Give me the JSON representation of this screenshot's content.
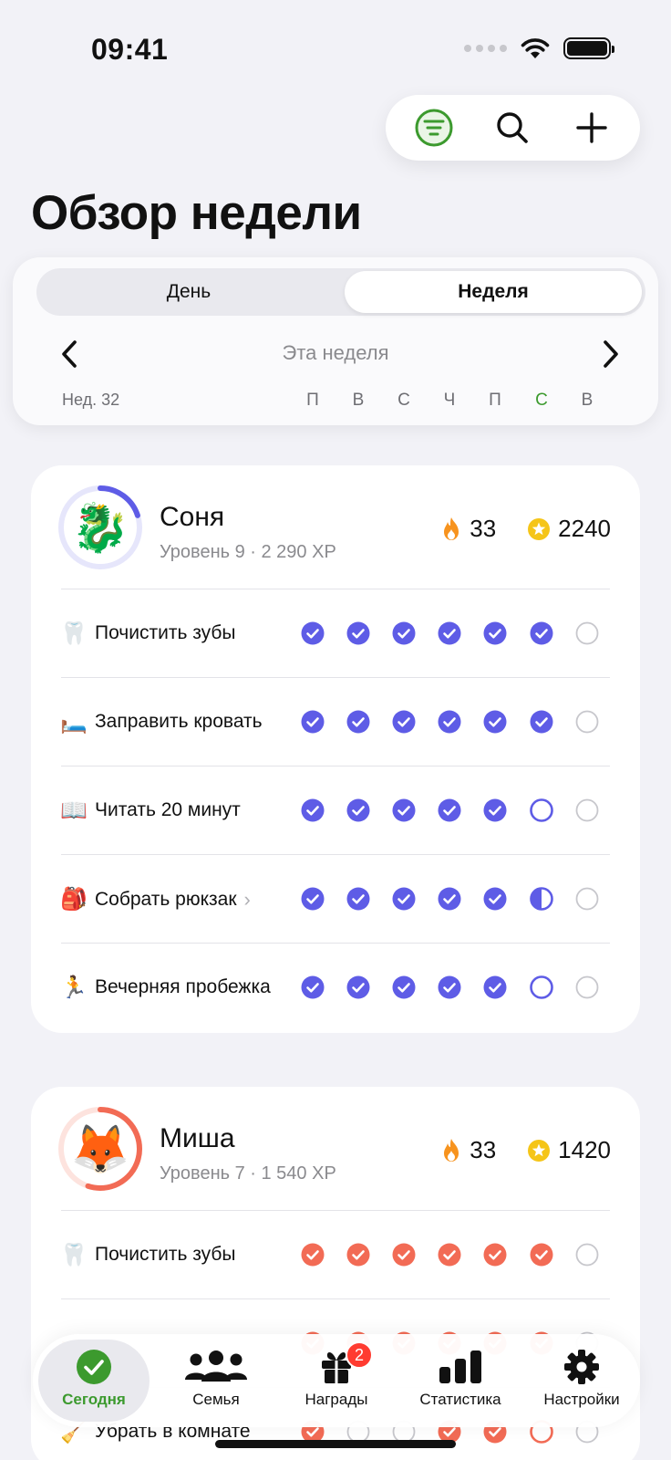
{
  "status": {
    "time": "09:41"
  },
  "page": {
    "title": "Обзор недели"
  },
  "period": {
    "segments": [
      "День",
      "Неделя"
    ],
    "selected": "Неделя",
    "label": "Эта неделя",
    "week_number": "Нед. 32",
    "weekdays": [
      "П",
      "В",
      "С",
      "Ч",
      "П",
      "С",
      "В"
    ],
    "today_index": 5,
    "today_color": "#3c9a2e"
  },
  "members": [
    {
      "name": "Соня",
      "subtitle": "Уровень 9 · 2 290 XP",
      "avatar_emoji": "🐉",
      "ring_color": "#5e5ce6",
      "ring_track": "#e6e6fb",
      "level_progress": 0.2,
      "streak": "33",
      "stars": "2240",
      "accent": "#5e5ce6",
      "tasks": [
        {
          "emoji": "🦷",
          "label": "Почистить зубы",
          "has_chevron": false,
          "days": [
            "done",
            "done",
            "done",
            "done",
            "done",
            "done",
            "empty"
          ]
        },
        {
          "emoji": "🛏️",
          "label": "Заправить кровать",
          "has_chevron": false,
          "days": [
            "done",
            "done",
            "done",
            "done",
            "done",
            "done",
            "empty"
          ]
        },
        {
          "emoji": "📖",
          "label": "Читать 20 минут",
          "has_chevron": false,
          "days": [
            "done",
            "done",
            "done",
            "done",
            "done",
            "open",
            "empty"
          ]
        },
        {
          "emoji": "🎒",
          "label": "Собрать рюкзак",
          "has_chevron": true,
          "days": [
            "done",
            "done",
            "done",
            "done",
            "done",
            "half",
            "empty"
          ]
        },
        {
          "emoji": "🏃",
          "label": "Вечерняя пробежка",
          "has_chevron": false,
          "days": [
            "done",
            "done",
            "done",
            "done",
            "done",
            "open",
            "empty"
          ]
        }
      ]
    },
    {
      "name": "Миша",
      "subtitle": "Уровень 7 · 1 540 XP",
      "avatar_emoji": "🦊",
      "ring_color": "#f26b55",
      "ring_track": "#fde3de",
      "level_progress": 0.55,
      "streak": "33",
      "stars": "1420",
      "accent": "#f26b55",
      "tasks": [
        {
          "emoji": "🦷",
          "label": "Почистить зубы",
          "has_chevron": false,
          "days": [
            "done",
            "done",
            "done",
            "done",
            "done",
            "done",
            "empty"
          ]
        },
        {
          "emoji": "🛏️",
          "label": "",
          "has_chevron": false,
          "days": [
            "done",
            "done",
            "done",
            "done",
            "done",
            "done",
            "empty"
          ]
        },
        {
          "emoji": "🧹",
          "label": "Убрать в комнате",
          "has_chevron": false,
          "days": [
            "done",
            "empty",
            "empty",
            "done",
            "done",
            "open",
            "empty"
          ]
        }
      ]
    }
  ],
  "tabs": [
    {
      "label": "Сегодня",
      "icon": "checkmark-circle-icon",
      "active": true
    },
    {
      "label": "Семья",
      "icon": "people-icon",
      "active": false
    },
    {
      "label": "Награды",
      "icon": "gift-icon",
      "active": false,
      "badge": "2"
    },
    {
      "label": "Статистика",
      "icon": "bar-chart-icon",
      "active": false
    },
    {
      "label": "Настройки",
      "icon": "gear-icon",
      "active": false
    }
  ],
  "colors": {
    "brand_green": "#3c9a2e",
    "streak_orange": "#f7931e",
    "star_yellow": "#f5c518",
    "badge_red": "#ff3b30"
  }
}
